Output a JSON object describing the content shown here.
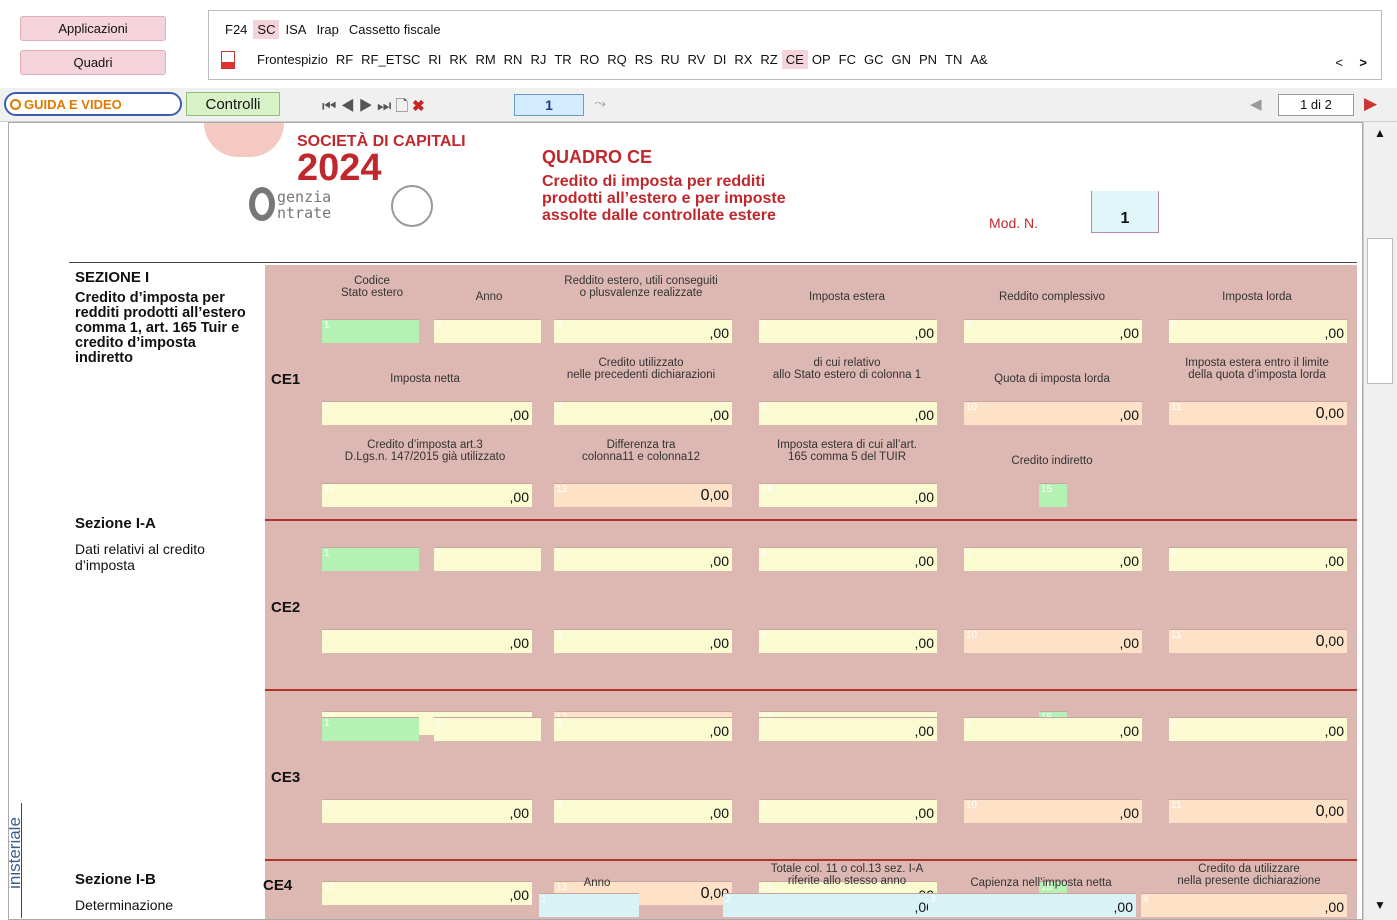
{
  "nav": {
    "apps": "Applicazioni",
    "quadri": "Quadri"
  },
  "tabs": [
    {
      "label": "F24",
      "sel": false
    },
    {
      "label": "SC",
      "sel": true
    },
    {
      "label": "ISA",
      "sel": false
    },
    {
      "label": "Irap",
      "sel": false
    },
    {
      "label": "Cassetto fiscale",
      "sel": false
    }
  ],
  "quadri": [
    {
      "label": "Frontespizio",
      "sel": false
    },
    {
      "label": "RF",
      "sel": false
    },
    {
      "label": "RF_ETSC",
      "sel": false
    },
    {
      "label": "RI",
      "sel": false
    },
    {
      "label": "RK",
      "sel": false
    },
    {
      "label": "RM",
      "sel": false
    },
    {
      "label": "RN",
      "sel": false
    },
    {
      "label": "RJ",
      "sel": false
    },
    {
      "label": "TR",
      "sel": false
    },
    {
      "label": "RO",
      "sel": false
    },
    {
      "label": "RQ",
      "sel": false
    },
    {
      "label": "RS",
      "sel": false
    },
    {
      "label": "RU",
      "sel": false
    },
    {
      "label": "RV",
      "sel": false
    },
    {
      "label": "DI",
      "sel": false
    },
    {
      "label": "RX",
      "sel": false
    },
    {
      "label": "RZ",
      "sel": false
    },
    {
      "label": "CE",
      "sel": true
    },
    {
      "label": "OP",
      "sel": false
    },
    {
      "label": "FC",
      "sel": false
    },
    {
      "label": "GC",
      "sel": false
    },
    {
      "label": "GN",
      "sel": false
    },
    {
      "label": "PN",
      "sel": false
    },
    {
      "label": "TN",
      "sel": false
    },
    {
      "label": "A&",
      "sel": false
    }
  ],
  "quadri_prev": "<",
  "quadri_next": ">",
  "toolbar": {
    "guida": "GUIDA E VIDEO",
    "controlli": "Controlli",
    "page_input": "1",
    "page_of": "1 di 2"
  },
  "header": {
    "brand1": "SOCIETÀ DI CAPITALI",
    "year": "2024",
    "agency1": "genzia",
    "agency2": "ntrate",
    "quadro_title": "QUADRO CE",
    "quadro_sub1": "Credito di imposta per redditi",
    "quadro_sub2": "prodotti all’estero e per imposte",
    "quadro_sub3": "assolte dalle controllate estere",
    "mod_label": "Mod. N.",
    "mod_value": "1"
  },
  "sections": {
    "s1_title": "SEZIONE I",
    "s1_desc": "Credito d’imposta per redditi prodotti all’estero comma 1, art. 165 Tuir e credito d’imposta indiretto",
    "s1a_title": "Sezione I-A",
    "s1a_desc": "Dati relativi al credito d’imposta",
    "s1b_title": "Sezione I-B",
    "s1b_desc": "Determinazione",
    "side": "inisteriale"
  },
  "col_headers": {
    "h1": "Codice\nStato estero",
    "h2": "Anno",
    "h3": "Reddito estero, utili conseguiti\no plusvalenze realizzate",
    "h4": "Imposta estera",
    "h5": "Reddito complessivo",
    "h6": "Imposta lorda",
    "h7": "Imposta netta",
    "h8": "Credito utilizzato\nnelle precedenti dichiarazioni",
    "h9": "di cui relativo\nallo Stato estero di colonna 1",
    "h10": "Quota di imposta lorda",
    "h11": "Imposta estera entro il limite\ndella quota d’imposta lorda",
    "h12": "Credito d’imposta art.3\nD.Lgs.n. 147/2015 già utilizzato",
    "h13": "Differenza tra\ncolonna11 e colonna12",
    "h14": "Imposta estera di cui all’art.\n165 comma 5 del TUIR",
    "h15": "Credito indiretto",
    "ce4_anno": "Anno",
    "ce4_totale": "Totale col. 11 o col.13 sez. I-A\nriferite allo stesso anno",
    "ce4_capienza": "Capienza nell’imposta netta",
    "ce4_credito": "Credito da utilizzare\nnella presente dichiarazione"
  },
  "rows": {
    "ce1": "CE1",
    "ce2": "CE2",
    "ce3": "CE3",
    "ce4": "CE4"
  },
  "values": {
    "zero_cents": ",00",
    "zero": "0"
  },
  "colors": {
    "pink": "#ddb8b3",
    "yellow": "#fbfbd2",
    "orange": "#fde2c8",
    "green": "#b3f2b3",
    "red": "#b3322f"
  }
}
